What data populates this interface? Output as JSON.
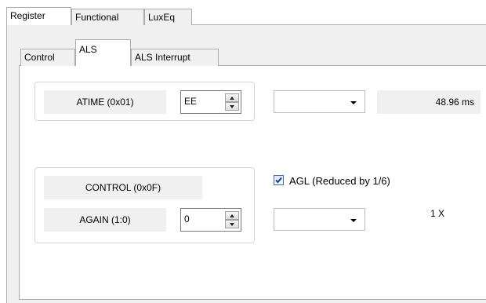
{
  "outer_tabs": [
    {
      "label": "Register"
    },
    {
      "label": "Functional"
    },
    {
      "label": "LuxEq"
    }
  ],
  "inner_tabs": [
    {
      "label": "Control"
    },
    {
      "label": "ALS"
    },
    {
      "label": "ALS Interrupt"
    }
  ],
  "atime": {
    "label": "ATIME (0x01)",
    "value": "EE",
    "dropdown_value": "",
    "readout": "48.96 ms"
  },
  "control": {
    "label": "CONTROL (0x0F)",
    "again_label": "AGAIN (1:0)",
    "again_value": "0",
    "agl_label": "AGL (Reduced by 1/6)",
    "agl_checked": true,
    "again_dropdown_value": "",
    "gain_readout": "1 X"
  }
}
